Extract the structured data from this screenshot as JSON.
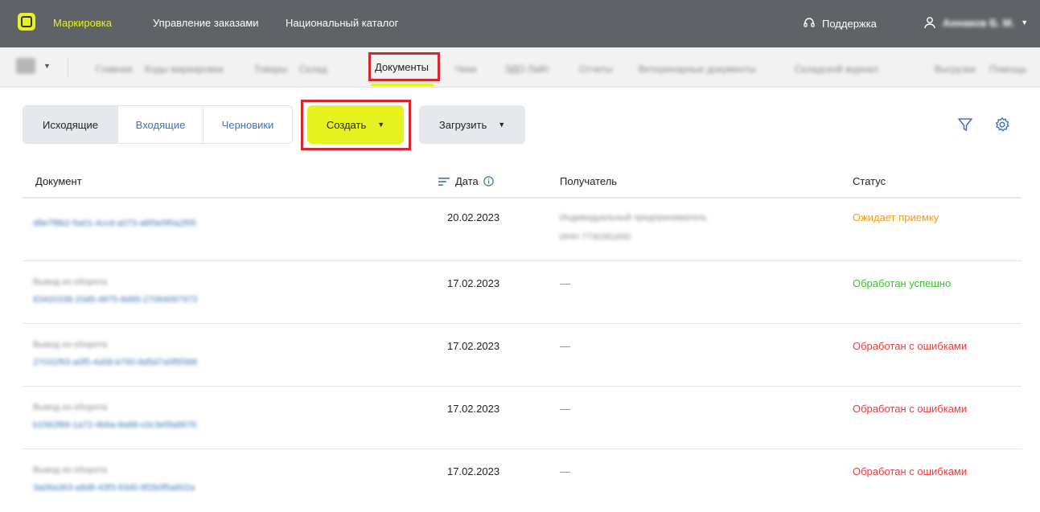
{
  "topbar": {
    "nav": [
      "Маркировка",
      "Управление заказами",
      "Национальный каталог"
    ],
    "support_label": "Поддержка",
    "user_name": "Аннаков Б. М.",
    "accent_color": "#e8f221"
  },
  "tabs": {
    "items": [
      "Главная",
      "Коды маркировки",
      "Товары",
      "Склад",
      "Документы",
      "Чеки",
      "ЭДО Лайт",
      "Отчеты",
      "Ветеринарные документы",
      "Складской журнал",
      "Выгрузки",
      "Помощь"
    ],
    "active_index": 4
  },
  "toolbar": {
    "segments": [
      "Исходящие",
      "Входящие",
      "Черновики"
    ],
    "create_label": "Создать",
    "upload_label": "Загрузить",
    "icons": [
      "filter-icon",
      "settings-gear-icon"
    ]
  },
  "table": {
    "columns": {
      "document": "Документ",
      "date": "Дата",
      "recipient": "Получатель",
      "status": "Статус"
    },
    "rows": [
      {
        "doc_type": "",
        "doc_id": "d8e7f8b2-5a01-4ccd-a073-a6f3e5f0a2f05",
        "date": "20.02.2023",
        "recipient": "Индивидуальный предприниматель",
        "recipient_inn": "ИНН 7730381650",
        "status": "Ожидает приемку",
        "status_color": "#f39a1d"
      },
      {
        "doc_type": "Вывод из оборота",
        "doc_id": "83420338-20d9-4875-8d99-27064097973",
        "date": "17.02.2023",
        "recipient": "—",
        "recipient_inn": "",
        "status": "Обработан успешно",
        "status_color": "#3cbf2e"
      },
      {
        "doc_type": "Вывод из оборота",
        "doc_id": "27031f93-a0f5-4a58-b760-8d5d7a5f5f368",
        "date": "17.02.2023",
        "recipient": "—",
        "recipient_inn": "",
        "status": "Обработан с ошибками",
        "status_color": "#ef3b3b"
      },
      {
        "doc_type": "Вывод из оборота",
        "doc_id": "b1562f89-1a72-4b6a-8a88-c0c3e5fa8678",
        "date": "17.02.2023",
        "recipient": "—",
        "recipient_inn": "",
        "status": "Обработан с ошибками",
        "status_color": "#ef3b3b"
      },
      {
        "doc_type": "Вывод из оборота",
        "doc_id": "3a06a363-a8d8-43f3-93d0-8f2b0f5a802a",
        "date": "17.02.2023",
        "recipient": "—",
        "recipient_inn": "",
        "status": "Обработан с ошибками",
        "status_color": "#ef3b3b"
      }
    ]
  }
}
